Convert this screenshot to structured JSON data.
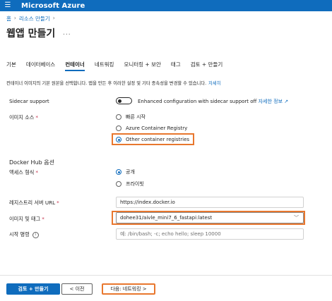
{
  "app": {
    "title": "Microsoft Azure",
    "menu_icon": "hamburger-icon"
  },
  "breadcrumbs": [
    "홈",
    "리소스 만들기"
  ],
  "page": {
    "title": "웹앱 만들기",
    "more": "..."
  },
  "tabs": [
    {
      "label": "기본",
      "active": false
    },
    {
      "label": "데이터베이스",
      "active": false
    },
    {
      "label": "컨테이너",
      "active": true
    },
    {
      "label": "네트워킹",
      "active": false
    },
    {
      "label": "모니터링 + 보안",
      "active": false
    },
    {
      "label": "태그",
      "active": false
    },
    {
      "label": "검토 + 만들기",
      "active": false
    }
  ],
  "description": {
    "text": "컨테이너 이미지의 기본 원본을 선택합니다. 앱을 만든 후 이러한 설정 및 기타 종속성을 변경할 수 있습니다.",
    "link": "자세히"
  },
  "sidecar": {
    "label": "Sidecar support",
    "toggle_text": "Enhanced configuration with sidecar support off",
    "link": "자세한 정보",
    "state": "off"
  },
  "image_source": {
    "label": "이미지 소스",
    "required": "*",
    "options": [
      "빠른 시작",
      "Azure Container Registry",
      "Other container registries"
    ],
    "selected": "Other container registries"
  },
  "docker_hub": {
    "section_title": "Docker Hub 옵션"
  },
  "access_type": {
    "label": "액세스 형식",
    "required": "*",
    "options": [
      "공개",
      "프라이빗"
    ],
    "selected": "공개"
  },
  "registry_url": {
    "label": "레지스트리 서버 URL",
    "required": "*",
    "value": "https://index.docker.io"
  },
  "image_tag": {
    "label": "이미지 및 태그",
    "required": "*",
    "value": "dohee31/aivle_mini7_6_fastapi:latest"
  },
  "startup_command": {
    "label": "시작 명령",
    "placeholder": "예: /bin/bash; -c; echo hello; sleep 10000"
  },
  "footer": {
    "review_create": "검토 + 만들기",
    "previous": "< 이전",
    "next": "다음: 네트워킹 >"
  },
  "colors": {
    "accent": "#0f6cbd",
    "highlight": "#e8772e"
  }
}
